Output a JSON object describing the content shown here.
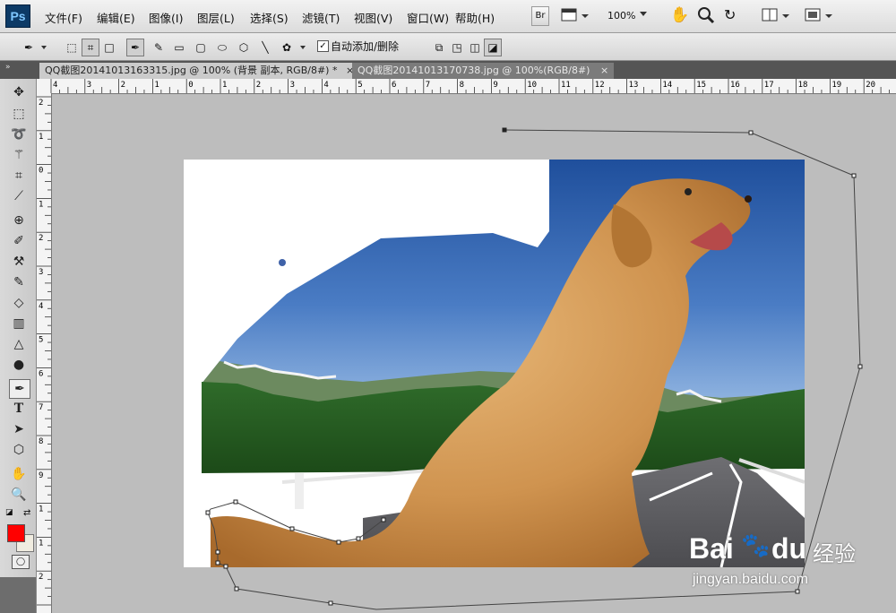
{
  "app": {
    "logo": "Ps"
  },
  "menu": [
    {
      "label": "文件(F)"
    },
    {
      "label": "编辑(E)"
    },
    {
      "label": "图像(I)"
    },
    {
      "label": "图层(L)"
    },
    {
      "label": "选择(S)"
    },
    {
      "label": "滤镜(T)"
    },
    {
      "label": "视图(V)"
    },
    {
      "label": "窗口(W)"
    },
    {
      "label": "帮助(H)"
    }
  ],
  "toolbar": {
    "bridge_label": "Br",
    "zoom": "100%"
  },
  "options": {
    "auto_add_delete": "自动添加/删除",
    "auto_add_checked": true
  },
  "tabs": [
    {
      "label": "QQ截图20141013163315.jpg @ 100% (背景 副本, RGB/8#) *",
      "close": "×",
      "active": true
    },
    {
      "label": "QQ截图20141013170738.jpg @ 100%(RGB/8#)",
      "close": "×",
      "active": false
    }
  ],
  "ruler": {
    "h_labels": [
      "4",
      "3",
      "2",
      "1",
      "0",
      "1",
      "2",
      "3",
      "4",
      "5",
      "6",
      "7",
      "8",
      "9",
      "10",
      "11",
      "12",
      "13",
      "14",
      "15",
      "16",
      "17",
      "18",
      "19",
      "20"
    ],
    "v_labels": [
      "2",
      "1",
      "0",
      "1",
      "2",
      "3",
      "4",
      "5",
      "6",
      "7",
      "8",
      "9",
      "1",
      "1",
      "2"
    ]
  },
  "colors": {
    "foreground": "#ff0000",
    "background": "#f0ece0"
  },
  "watermark": {
    "brand": "Bai",
    "brand2": "du",
    "cn": "经验",
    "url": "jingyan.baidu.com"
  },
  "icons": {
    "move": "move-tool-icon",
    "marquee": "rect-marquee-icon",
    "lasso": "lasso-icon",
    "wand": "magic-wand-icon",
    "crop": "crop-icon",
    "eyedrop": "eyedropper-icon",
    "heal": "healing-brush-icon",
    "brush": "brush-icon",
    "stamp": "clone-stamp-icon",
    "history": "history-brush-icon",
    "eraser": "eraser-icon",
    "gradient": "gradient-icon",
    "blur": "blur-icon",
    "dodge": "dodge-icon",
    "pen": "pen-tool-icon",
    "type": "type-tool-icon",
    "select": "path-select-icon",
    "shape": "shape-tool-icon",
    "hand": "hand-icon",
    "zoom": "zoom-icon"
  }
}
